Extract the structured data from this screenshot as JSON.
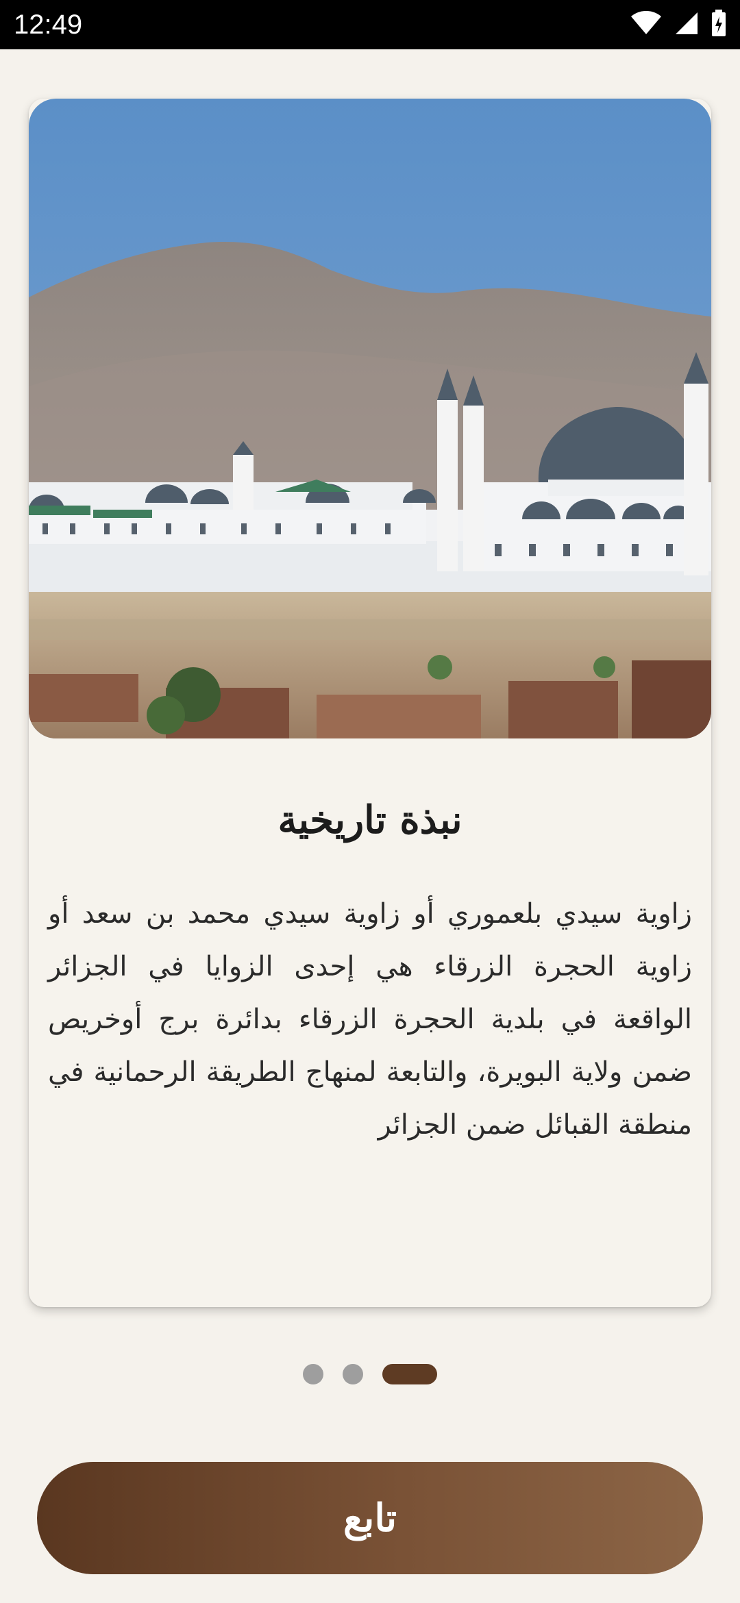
{
  "status_bar": {
    "time": "12:49",
    "icons": [
      "wifi-icon",
      "signal-icon",
      "battery-icon"
    ]
  },
  "card": {
    "image_alt": "mosque-photo",
    "title": "نبذة تاريخية",
    "body": "زاوية سيدي بلعموري أو زاوية سيدي محمد بن سعد أو زاوية الحجرة الزرقاء هي إحدى الزوايا في الجزائر الواقعة في بلدية الحجرة الزرقاء بدائرة برج أوخريص ضمن ولاية البويرة، والتابعة لمنهاج الطريقة الرحمانية في منطقة القبائل ضمن الجزائر"
  },
  "pager": {
    "count": 3,
    "active_index": 2
  },
  "continue_button": {
    "label": "تابع"
  },
  "colors": {
    "background": "#f5f2ec",
    "accent": "#5e3b23",
    "dot_inactive": "#9e9e9e"
  }
}
